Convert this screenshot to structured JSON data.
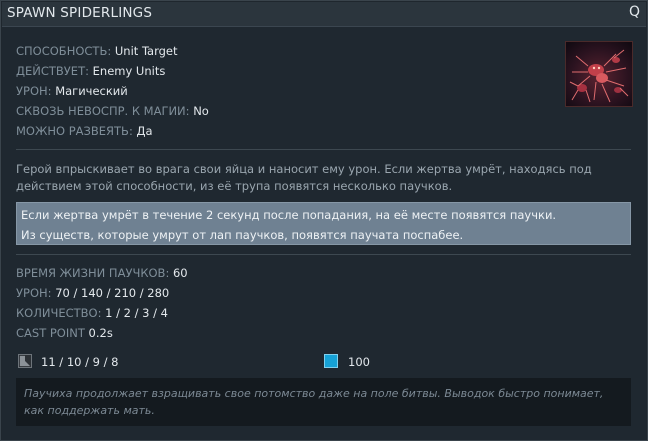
{
  "ability": {
    "name": "SPAWN SPIDERLINGS",
    "hotkey": "Q"
  },
  "attributes": [
    {
      "key": "СПОСОБНОСТЬ:",
      "value": "Unit Target"
    },
    {
      "key": "ДЕЙСТВУЕТ:",
      "value": "Enemy Units"
    },
    {
      "key": "УРОН:",
      "value": "Магический"
    },
    {
      "key": "СКВОЗЬ НЕВОСПР. К МАГИИ:",
      "value": "No"
    },
    {
      "key": "МОЖНО РАЗВЕЯТЬ:",
      "value": "Да"
    }
  ],
  "description": "Герой впрыскивает во врага свои яйца и наносит ему урон. Если жертва умрёт, находясь под действием этой способности, из её трупа появятся несколько паучков.",
  "notes": [
    "Если жертва умрёт в течение 2 секунд после попадания, на её месте появятся паучки.",
    "Из существ, которые умрут от лап паучков, появятся паучата поспабее."
  ],
  "stats": [
    {
      "key": "ВРЕМЯ ЖИЗНИ ПАУЧКОВ:",
      "value": "60"
    },
    {
      "key": "УРОН:",
      "value": "70 / 140 / 210 / 280"
    },
    {
      "key": "КОЛИЧЕСТВО:",
      "value": "1 / 2 / 3 / 4"
    },
    {
      "key": "CAST POINT",
      "value": "0.2s"
    }
  ],
  "costs": {
    "cooldown": {
      "icon": "cooldown-icon",
      "value": "11 / 10 / 9 / 8"
    },
    "mana": {
      "icon": "mana-icon",
      "value": "100",
      "color": "#16a2d6"
    }
  },
  "lore": "Паучиха продолжает взращивать свое потомство даже на поле битвы. Выводок быстро понимает, как поддержать мать."
}
